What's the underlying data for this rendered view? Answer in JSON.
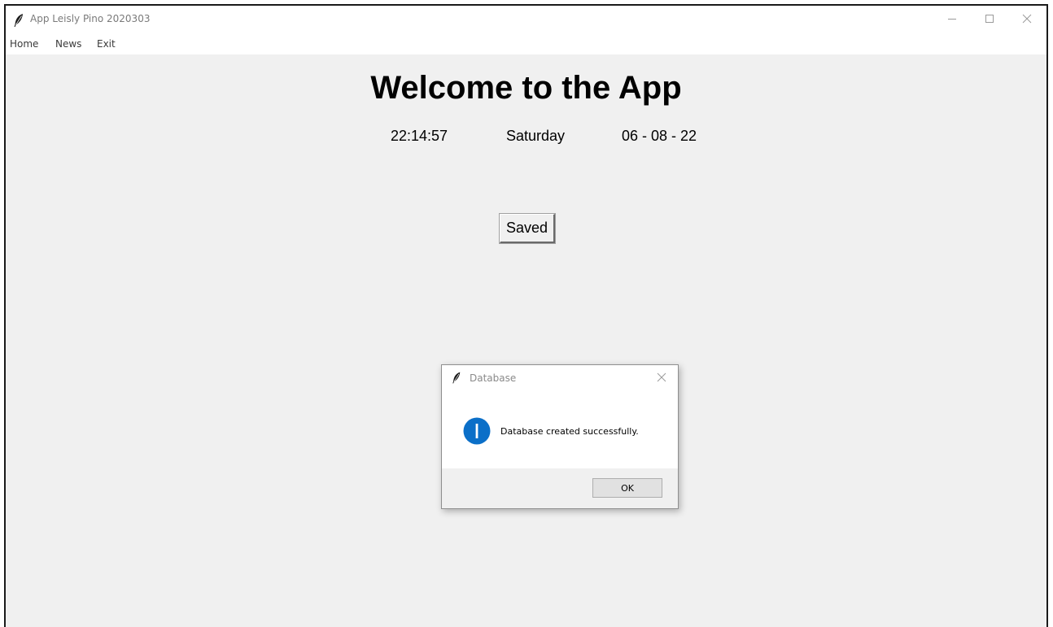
{
  "window": {
    "title": "App Leisly Pino 2020303"
  },
  "menubar": {
    "items": [
      "Home",
      "News",
      "Exit"
    ]
  },
  "main": {
    "heading": "Welcome to the App",
    "time": "22:14:57",
    "day": "Saturday",
    "date": "06 - 08 - 22",
    "saved_button_label": "Saved"
  },
  "dialog": {
    "title": "Database",
    "message": "Database created successfully.",
    "ok_label": "OK",
    "icon": "info-icon"
  },
  "colors": {
    "background": "#f0f0f0",
    "info_icon": "#0b6fc8"
  }
}
